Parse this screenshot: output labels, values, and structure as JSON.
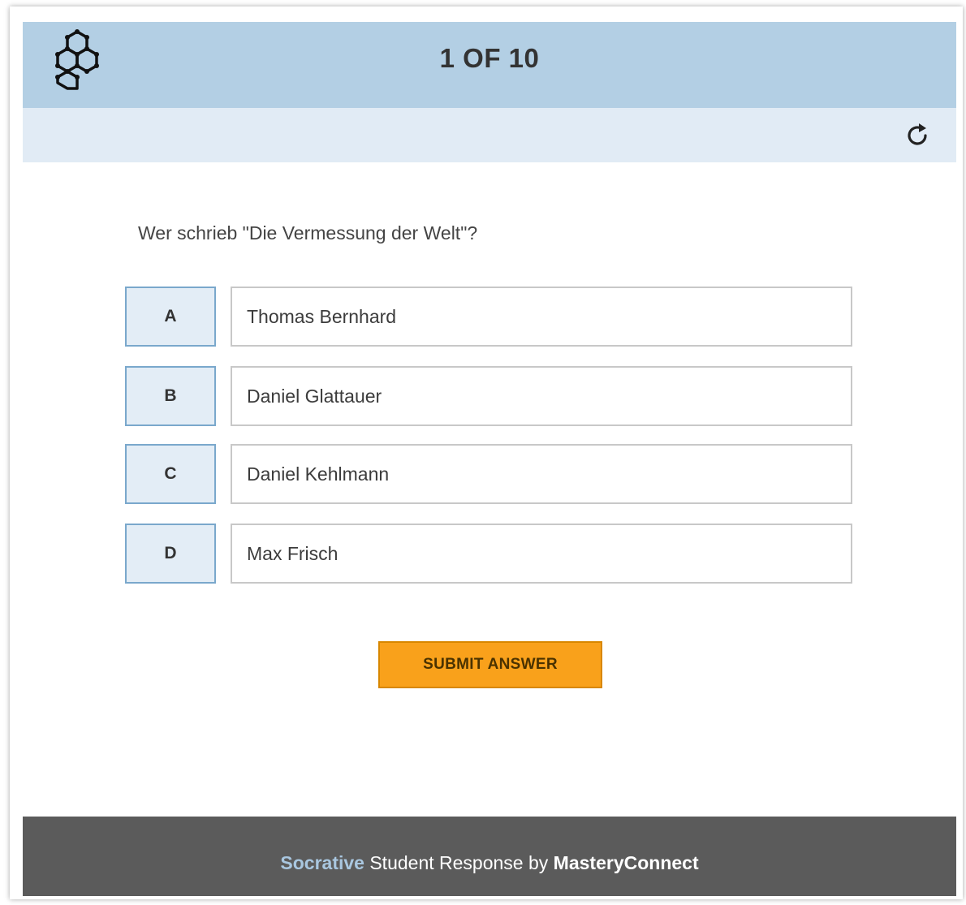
{
  "header": {
    "progress": "1 OF 10",
    "logo_icon": "hexagon-molecule-icon"
  },
  "toolbar": {
    "refresh_icon": "refresh-icon"
  },
  "question": {
    "text": "Wer schrieb \"Die Vermessung der Welt\"?"
  },
  "answers": [
    {
      "letter": "A",
      "text": "Thomas Bernhard"
    },
    {
      "letter": "B",
      "text": "Daniel Glattauer"
    },
    {
      "letter": "C",
      "text": "Daniel Kehlmann"
    },
    {
      "letter": "D",
      "text": "Max Frisch"
    }
  ],
  "submit": {
    "label": "SUBMIT ANSWER"
  },
  "footer": {
    "brand": "Socrative",
    "middle": " Student Response by ",
    "company": "MasteryConnect"
  },
  "colors": {
    "header_bg": "#b3cfe4",
    "subbar_bg": "#e1ebf5",
    "submit_bg": "#f9a11b",
    "footer_bg": "#5b5b5b",
    "brand_accent": "#a9c7e0"
  }
}
